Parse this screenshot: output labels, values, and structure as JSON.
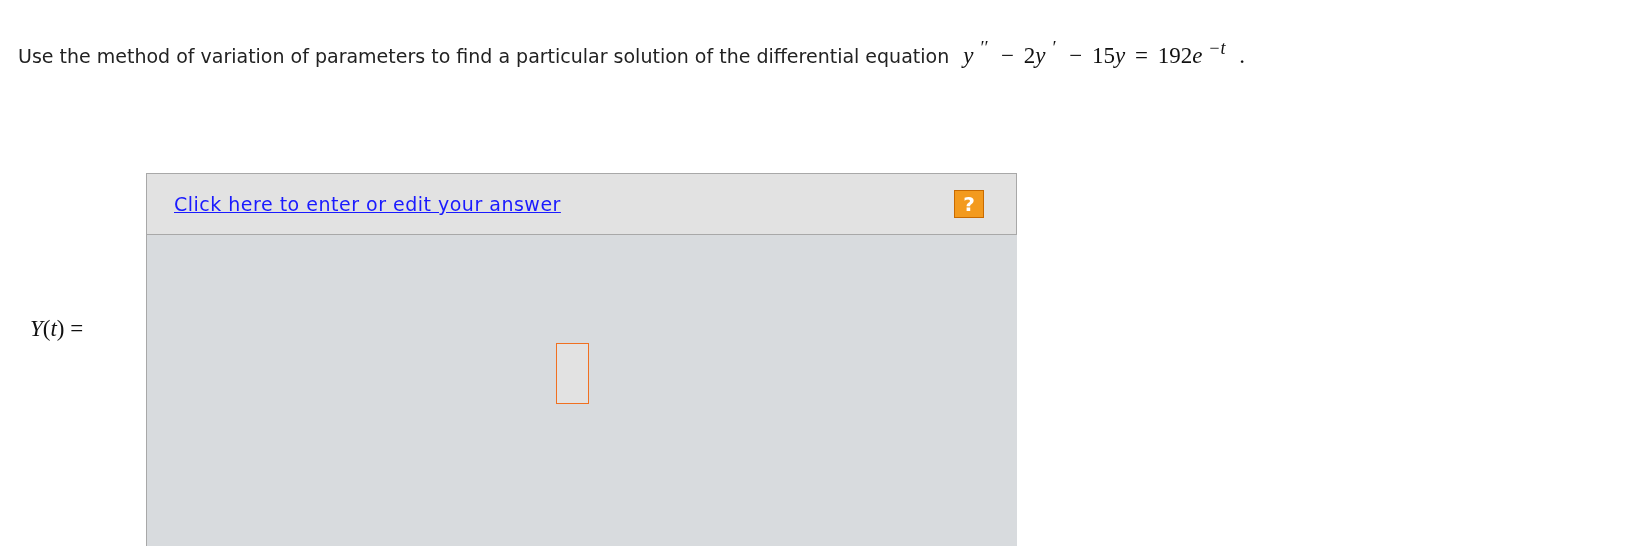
{
  "question": {
    "prompt": "Use the method of variation of parameters to find a particular solution of the differential equation",
    "equation": [
      {
        "kind": "var",
        "text": "y"
      },
      {
        "kind": "sup",
        "text": "′′"
      },
      {
        "kind": "plain",
        "text": " − 2"
      },
      {
        "kind": "var",
        "text": "y"
      },
      {
        "kind": "sup",
        "text": "′"
      },
      {
        "kind": "plain",
        "text": " − 15"
      },
      {
        "kind": "var",
        "text": "y"
      },
      {
        "kind": "plain",
        "text": " = 192"
      },
      {
        "kind": "var",
        "text": "e"
      },
      {
        "kind": "sup",
        "text": "−t"
      },
      {
        "kind": "plain",
        "text": " ."
      }
    ]
  },
  "answer": {
    "label": "*Y*(*t*) =",
    "link": "Click here to enter or edit your answer",
    "help_icon": "?"
  }
}
